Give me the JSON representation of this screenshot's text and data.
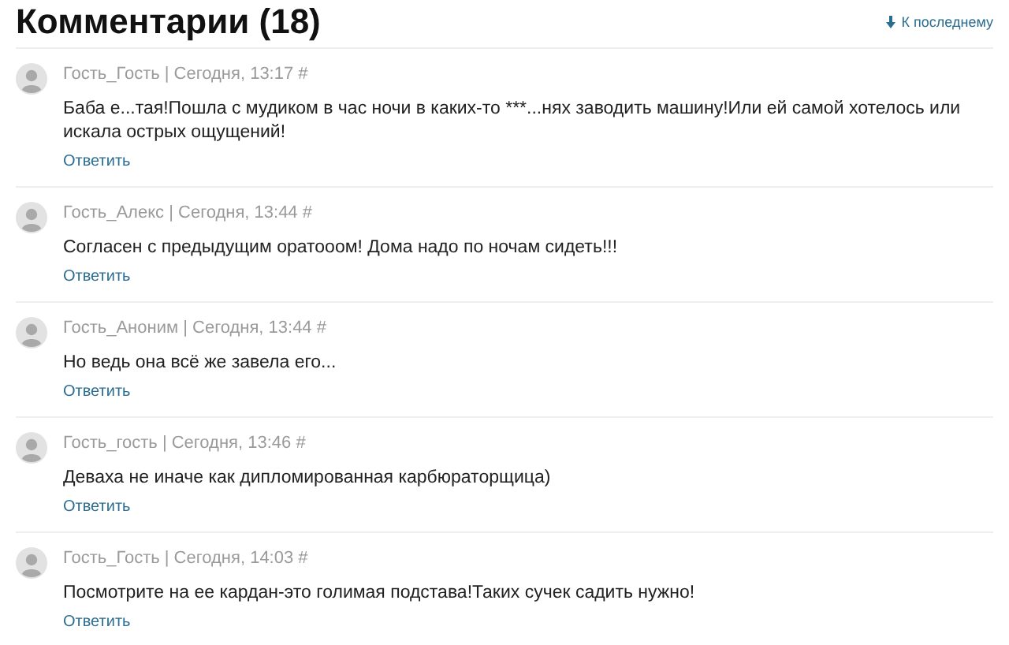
{
  "header": {
    "title": "Комментарии (18)",
    "jump_link": "К последнему"
  },
  "comments": [
    {
      "meta": "Гость_Гость | Сегодня, 13:17 #",
      "text": "Баба е...тая!Пошла с мудиком в час ночи в каких-то ***...нях заводить машину!Или ей самой хотелось или искала острых ощущений!",
      "reply": "Ответить"
    },
    {
      "meta": "Гость_Алекс | Сегодня, 13:44 #",
      "text": "Согласен с предыдущим оратооом! Дома надо по ночам сидеть!!!",
      "reply": "Ответить"
    },
    {
      "meta": "Гость_Аноним | Сегодня, 13:44 #",
      "text": "Но ведь она всё же завела его...",
      "reply": "Ответить"
    },
    {
      "meta": "Гость_гость | Сегодня, 13:46 #",
      "text": "Деваха не иначе как дипломированная карбюраторщица)",
      "reply": "Ответить"
    },
    {
      "meta": "Гость_Гость | Сегодня, 14:03 #",
      "text": "Посмотрите на ее кардан-это голимая подстава!Таких сучек садить нужно!",
      "reply": "Ответить"
    }
  ]
}
